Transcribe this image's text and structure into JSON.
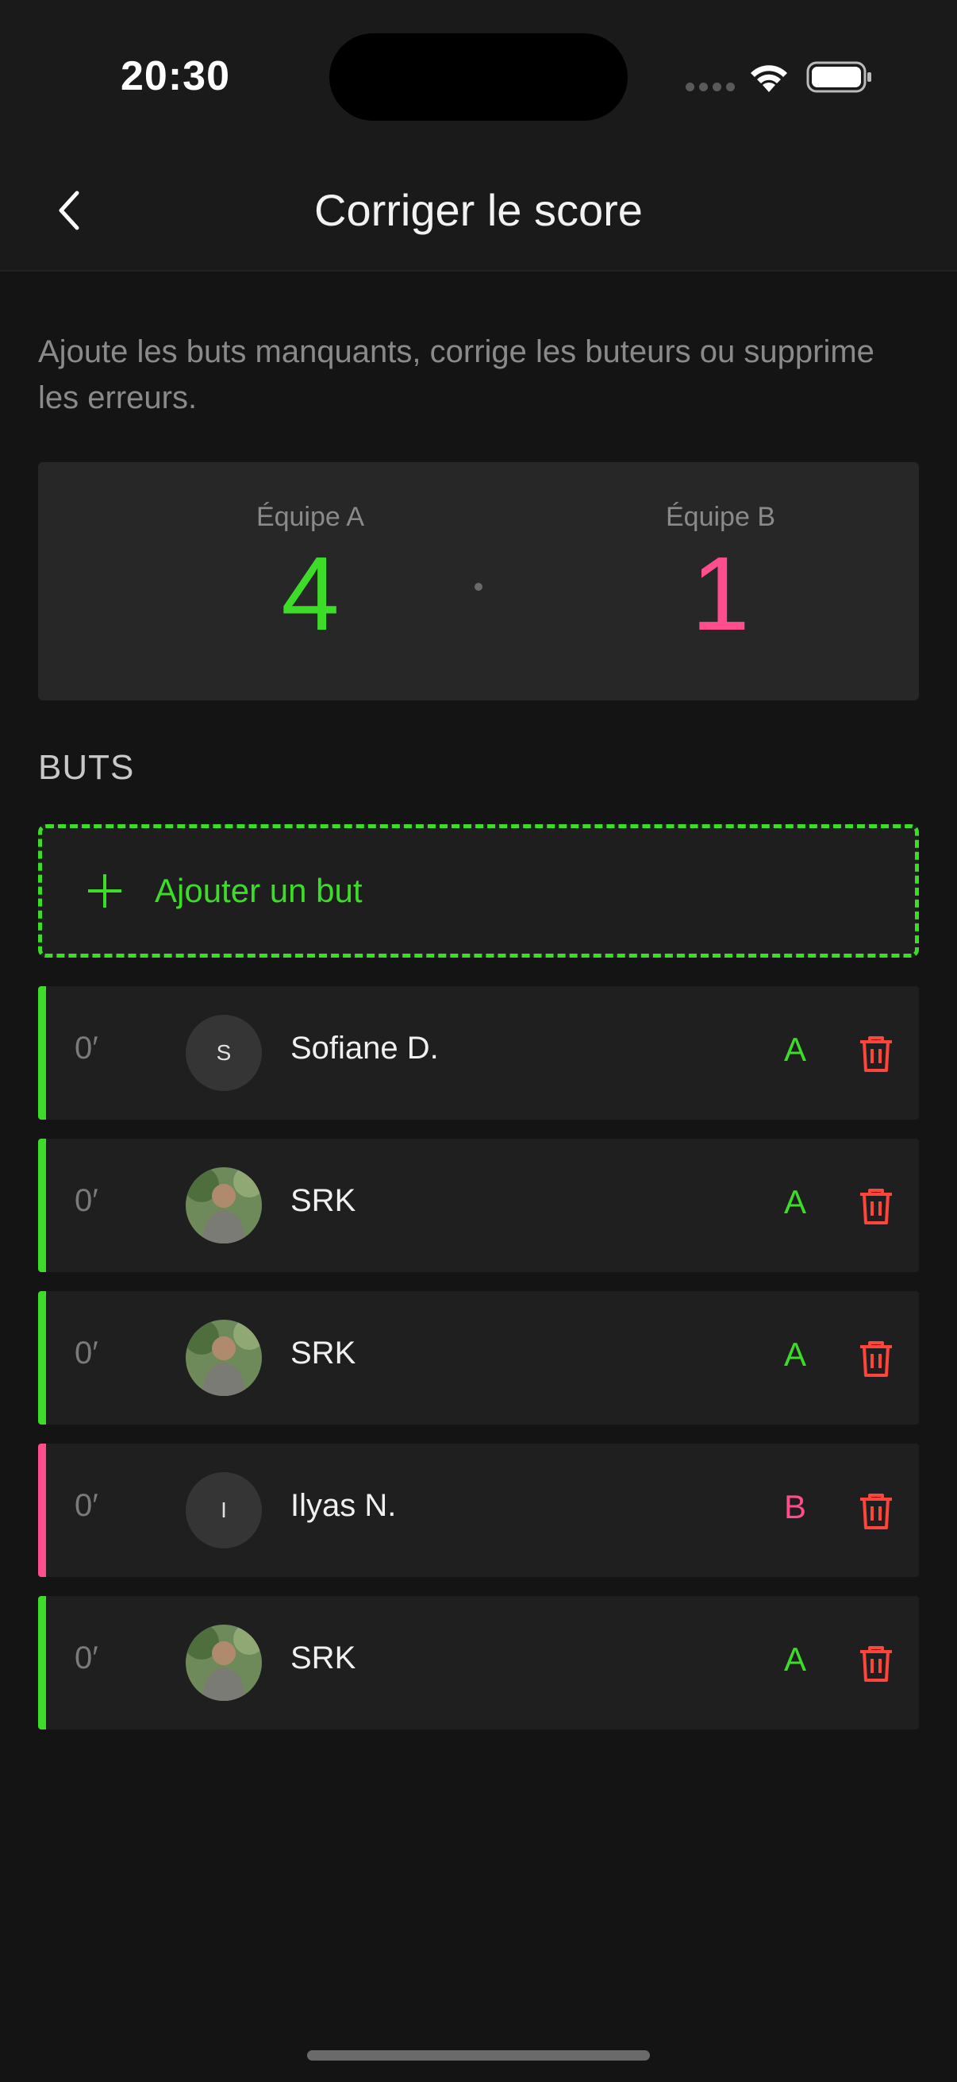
{
  "status_bar": {
    "time": "20:30"
  },
  "header": {
    "title": "Corriger le score"
  },
  "description": "Ajoute les buts manquants, corrige les buteurs ou supprime les erreurs.",
  "score": {
    "team_a_label": "Équipe A",
    "team_a_score": "4",
    "team_b_label": "Équipe B",
    "team_b_score": "1"
  },
  "goals_section": {
    "title": "BUTS",
    "add_label": "Ajouter un but",
    "goals": [
      {
        "minute": "0′",
        "player": "Sofiane D.",
        "initial": "S",
        "team": "A",
        "avatar": "initial"
      },
      {
        "minute": "0′",
        "player": "SRK",
        "initial": "",
        "team": "A",
        "avatar": "photo"
      },
      {
        "minute": "0′",
        "player": "SRK",
        "initial": "",
        "team": "A",
        "avatar": "photo"
      },
      {
        "minute": "0′",
        "player": "Ilyas N.",
        "initial": "I",
        "team": "B",
        "avatar": "initial"
      },
      {
        "minute": "0′",
        "player": "SRK",
        "initial": "",
        "team": "A",
        "avatar": "photo"
      }
    ]
  },
  "colors": {
    "team_a": "#3ddc28",
    "team_b": "#ff4d8d",
    "delete": "#ff453a"
  }
}
